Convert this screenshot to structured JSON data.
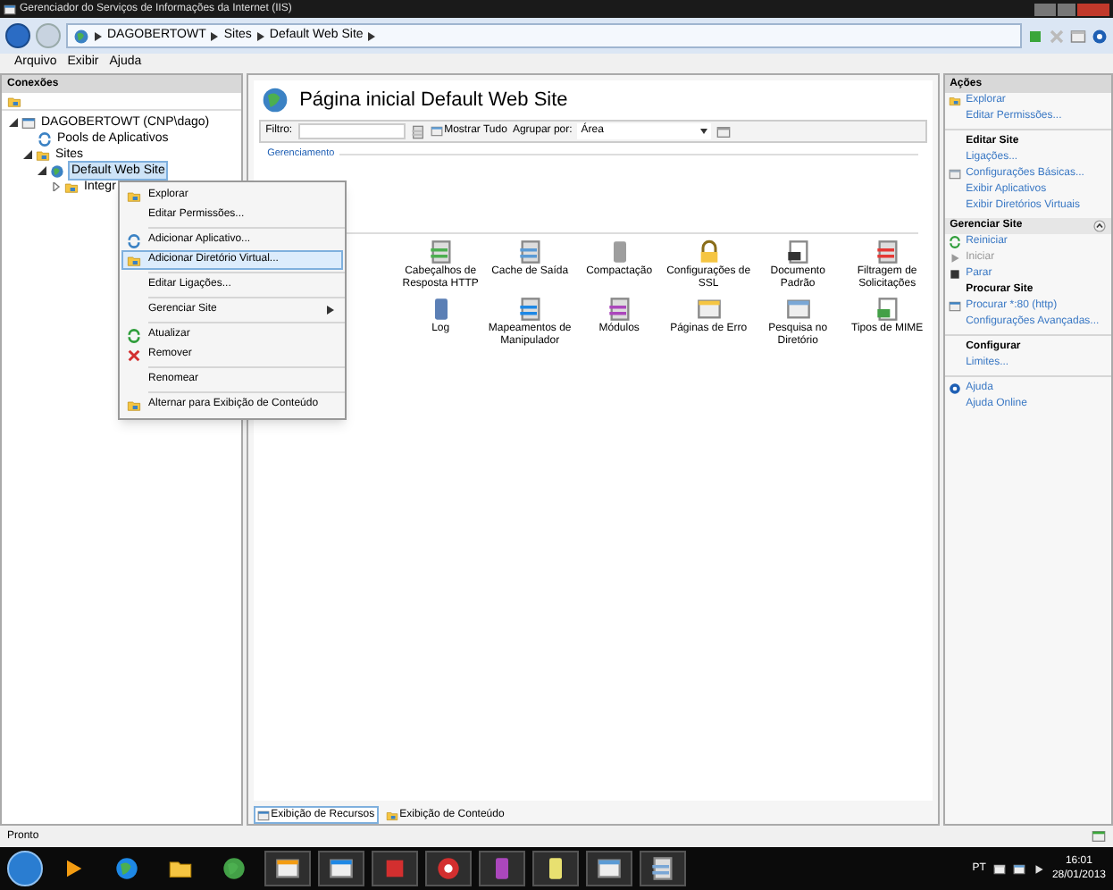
{
  "window": {
    "title": "Gerenciador do Serviços de Informações da Internet (IIS)"
  },
  "address_bar": {
    "path": [
      "DAGOBERTOWT",
      "Sites",
      "Default Web Site"
    ]
  },
  "menu": [
    "Arquivo",
    "Exibir",
    "Ajuda"
  ],
  "connections": {
    "title": "Conexões",
    "tree": [
      {
        "label": "DAGOBERTOWT (CNP\\dago)",
        "expanded": true,
        "selected": false,
        "children": [
          {
            "label": "Pools de Aplicativos",
            "selected": false
          },
          {
            "label": "Sites",
            "expanded": true,
            "selected": false,
            "children": [
              {
                "label": "Default Web Site",
                "expanded": true,
                "selected": true,
                "children": [
                  {
                    "label": "Integr",
                    "expanded": false,
                    "selected": false
                  }
                ]
              }
            ]
          }
        ]
      }
    ]
  },
  "page": {
    "title": "Página inicial Default Web Site",
    "filter_label": "Filtro:",
    "show_all": "Mostrar Tudo",
    "group_by": {
      "label": "Agrupar por:",
      "value": "Área"
    },
    "group": "Gerenciamento",
    "features": [
      "Cabeçalhos de Resposta HTTP",
      "Cache de Saída",
      "Compactação",
      "Configurações de SSL",
      "Documento Padrão",
      "Filtragem de Solicitações",
      "Log",
      "Mapeamentos de Manipulador",
      "Módulos",
      "Páginas de Erro",
      "Pesquisa no Diretório",
      "Tipos de MIME"
    ]
  },
  "view_tabs": [
    {
      "label": "Exibição de Recursos",
      "selected": true
    },
    {
      "label": "Exibição de Conteúdo",
      "selected": false
    }
  ],
  "context_menu": {
    "groups": [
      [
        {
          "label": "Explorar",
          "selected": false
        },
        {
          "label": "Editar Permissões...",
          "selected": false
        }
      ],
      [
        {
          "label": "Adicionar Aplicativo...",
          "selected": false
        },
        {
          "label": "Adicionar Diretório Virtual...",
          "selected": true
        }
      ],
      [
        {
          "label": "Editar Ligações...",
          "selected": false
        }
      ],
      [
        {
          "label": "Gerenciar Site",
          "selected": false,
          "submenu": true
        }
      ],
      [
        {
          "label": "Atualizar",
          "selected": false
        },
        {
          "label": "Remover",
          "selected": false
        }
      ],
      [
        {
          "label": "Renomear",
          "selected": false
        }
      ],
      [
        {
          "label": "Alternar para Exibição de Conteúdo",
          "selected": false
        }
      ]
    ]
  },
  "actions": {
    "title": "Ações",
    "sections": [
      {
        "kind": "plain",
        "items": [
          {
            "label": "Explorar",
            "disabled": false
          },
          {
            "label": "Editar Permissões...",
            "disabled": false
          }
        ]
      },
      {
        "kind": "plain",
        "title": "Editar Site",
        "items": [
          {
            "label": "Ligações...",
            "disabled": false
          },
          {
            "label": "Configurações Básicas...",
            "disabled": false
          },
          {
            "label": "Exibir Aplicativos",
            "disabled": false
          },
          {
            "label": "Exibir Diretórios Virtuais",
            "disabled": false
          }
        ]
      },
      {
        "kind": "pane",
        "title": "Gerenciar Site",
        "items": [
          {
            "label": "Reiniciar",
            "disabled": false
          },
          {
            "label": "Iniciar",
            "disabled": true
          },
          {
            "label": "Parar",
            "disabled": false
          }
        ]
      },
      {
        "kind": "plain",
        "title": "Procurar Site",
        "items": [
          {
            "label": "Procurar *:80 (http)",
            "disabled": false
          },
          {
            "label": "Configurações Avançadas...",
            "disabled": false
          }
        ]
      },
      {
        "kind": "plain",
        "title": "Configurar",
        "items": [
          {
            "label": "Limites...",
            "disabled": false
          }
        ]
      },
      {
        "kind": "plain",
        "items": [
          {
            "label": "Ajuda",
            "disabled": false
          },
          {
            "label": "Ajuda Online",
            "disabled": false
          }
        ]
      }
    ]
  },
  "status_bar": {
    "text": "Pronto"
  },
  "taskbar": {
    "language": "PT",
    "time": "16:01",
    "date": "28/01/2013"
  }
}
